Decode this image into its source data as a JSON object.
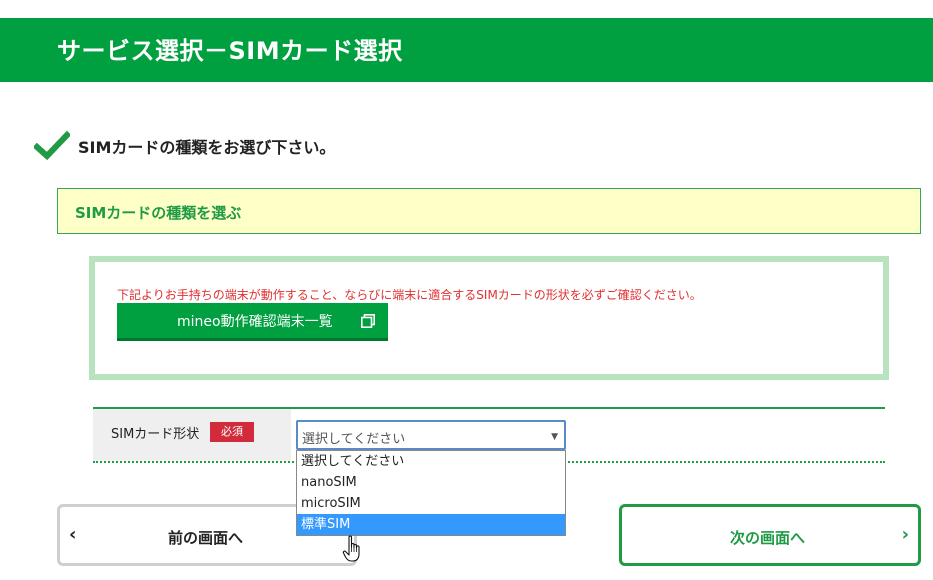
{
  "header": {
    "title": "サービス選択－SIMカード選択"
  },
  "instruction": {
    "text": "SIMカードの種類をお選び下さい。",
    "icon": "checkmark-icon"
  },
  "section": {
    "title": "SIMカードの種類を選ぶ"
  },
  "notice": {
    "text": "下記よりお手持ちの端末が動作すること、ならびに端末に適合するSIMカードの形状を必ずご確認ください。",
    "button_label": "mineo動作確認端末一覧",
    "button_icon": "new-window-icon"
  },
  "form": {
    "sim_label": "SIMカード形状",
    "required_badge": "必須",
    "select": {
      "current_value": "選択してください",
      "options": [
        "選択してください",
        "nanoSIM",
        "microSIM",
        "標準SIM"
      ],
      "highlighted_index": 3
    }
  },
  "navigation": {
    "prev_label": "前の画面へ",
    "prev_arrow": "‹",
    "next_label": "次の画面へ",
    "next_arrow": "›"
  },
  "colors": {
    "brand_green": "#00a040",
    "dark_green": "#1f9a45",
    "notice_red": "#e03030",
    "required_red": "#d22b3b",
    "highlight_blue": "#3399ff",
    "section_bg": "#ffffc8",
    "notice_border": "#b9e2bf"
  }
}
